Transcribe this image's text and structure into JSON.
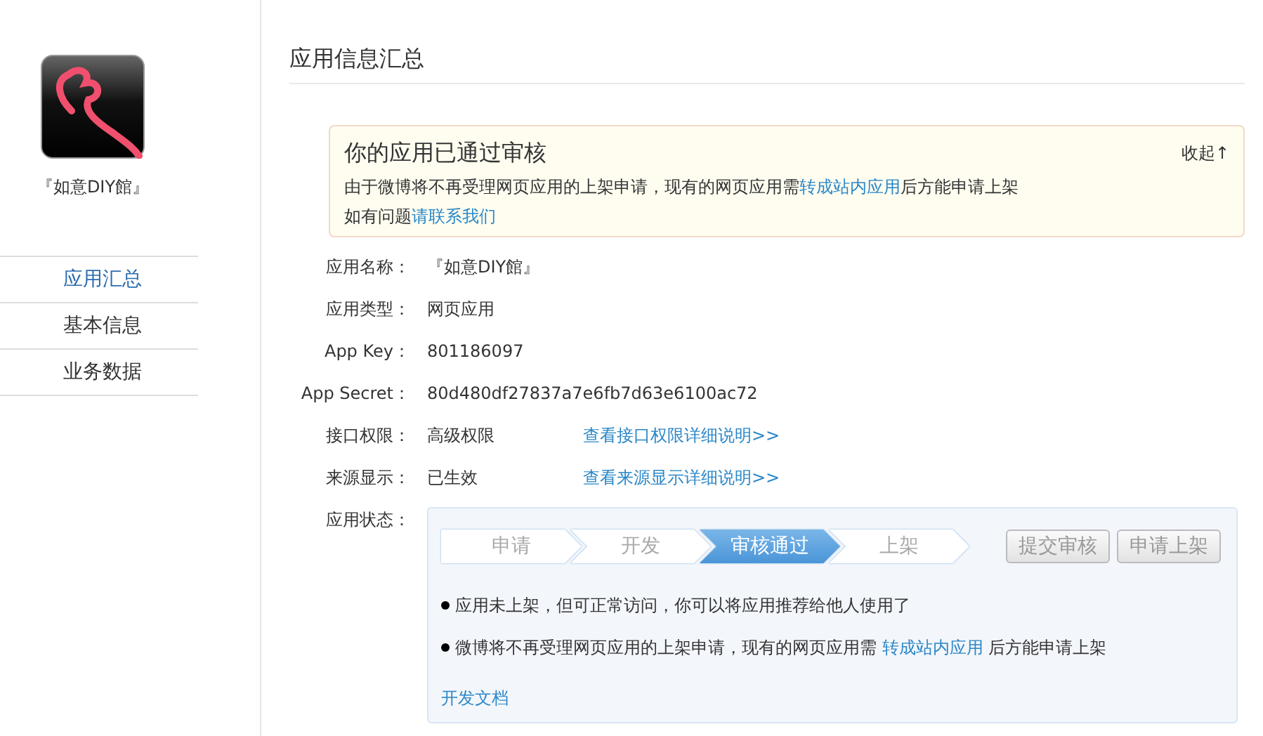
{
  "sidebar": {
    "app_name": "『如意DIY館』",
    "items": [
      {
        "label": "应用汇总",
        "selected": true
      },
      {
        "label": "基本信息",
        "selected": false
      },
      {
        "label": "业务数据",
        "selected": false
      }
    ]
  },
  "page_title": "应用信息汇总",
  "notice": {
    "title": "你的应用已通过审核",
    "collapse": "收起↑",
    "lines": [
      [
        {
          "kind": "text",
          "text": "由于微博将不再受理网页应用的上架申请，现有的网页应用需"
        },
        {
          "kind": "link",
          "text": "转成站内应用"
        },
        {
          "kind": "text",
          "text": "后方能申请上架"
        }
      ],
      [
        {
          "kind": "text",
          "text": "如有问题"
        },
        {
          "kind": "link",
          "text": "请联系我们"
        }
      ]
    ]
  },
  "fields": [
    {
      "label": "应用名称：",
      "value": "『如意DIY館』"
    },
    {
      "label": "应用类型：",
      "value": "网页应用"
    },
    {
      "label": "App Key：",
      "value": "801186097"
    },
    {
      "label": "App Secret：",
      "value": "80d480df27837a7e6fb7d63e6100ac72"
    },
    {
      "label": "接口权限：",
      "value": "高级权限",
      "link": "查看接口权限详细说明>>"
    },
    {
      "label": "来源显示：",
      "value": "已生效",
      "link": "查看来源显示详细说明>>"
    }
  ],
  "status": {
    "label": "应用状态：",
    "steps": [
      {
        "label": "申请",
        "selected": false
      },
      {
        "label": "开发",
        "selected": false
      },
      {
        "label": "审核通过",
        "selected": true
      },
      {
        "label": "上架",
        "selected": false
      }
    ],
    "buttons": [
      {
        "label": "提交审核",
        "disabled": true
      },
      {
        "label": "申请上架",
        "disabled": true
      }
    ],
    "bullets": [
      [
        {
          "kind": "text",
          "text": "应用未上架，但可正常访问，你可以将应用推荐给他人使用了"
        }
      ],
      [
        {
          "kind": "text",
          "text": "微博将不再受理网页应用的上架申请，现有的网页应用需 "
        },
        {
          "kind": "link",
          "text": "转成站内应用"
        },
        {
          "kind": "text",
          "text": " 后方能申请上架"
        }
      ]
    ],
    "doc_link": "开发文档"
  }
}
